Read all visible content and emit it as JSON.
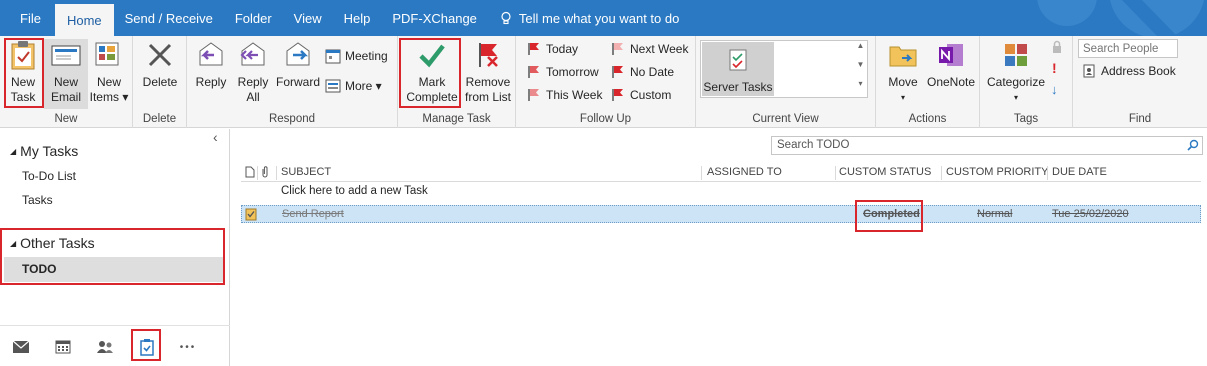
{
  "menubar": {
    "tabs": [
      "File",
      "Home",
      "Send / Receive",
      "Folder",
      "View",
      "Help",
      "PDF-XChange"
    ],
    "active_tab": "Home",
    "tell_me": "Tell me what you want to do"
  },
  "ribbon": {
    "new": {
      "label": "New",
      "new_task": [
        "New",
        "Task"
      ],
      "new_email": [
        "New",
        "Email"
      ],
      "new_items": [
        "New",
        "Items"
      ]
    },
    "delete": {
      "label": "Delete",
      "delete_btn": "Delete"
    },
    "respond": {
      "label": "Respond",
      "reply": "Reply",
      "reply_all": [
        "Reply",
        "All"
      ],
      "forward": "Forward",
      "meeting": "Meeting",
      "more": "More"
    },
    "manage_task": {
      "label": "Manage Task",
      "mark_complete": [
        "Mark",
        "Complete"
      ],
      "remove_from_list": [
        "Remove",
        "from List"
      ]
    },
    "follow_up": {
      "label": "Follow Up",
      "today": "Today",
      "tomorrow": "Tomorrow",
      "this_week": "This Week",
      "next_week": "Next Week",
      "no_date": "No Date",
      "custom": "Custom"
    },
    "current_view": {
      "label": "Current View",
      "server_tasks": "Server Tasks"
    },
    "actions": {
      "label": "Actions",
      "move": "Move",
      "onenote": "OneNote"
    },
    "tags": {
      "label": "Tags",
      "categorize": "Categorize"
    },
    "find": {
      "label": "Find",
      "search_people_placeholder": "Search People",
      "address_book": "Address Book"
    }
  },
  "nav": {
    "my_tasks": "My Tasks",
    "todo_list": "To-Do List",
    "tasks": "Tasks",
    "other_tasks": "Other Tasks",
    "todo": "TODO",
    "collapse_glyph": "‹",
    "more_glyph": "•••"
  },
  "main": {
    "search_placeholder": "Search TODO",
    "columns": {
      "subject": "SUBJECT",
      "assigned_to": "ASSIGNED TO",
      "custom_status": "CUSTOM STATUS",
      "custom_priority": "CUSTOM PRIORITY",
      "due_date": "DUE DATE"
    },
    "add_new": "Click here to add a new Task",
    "tasks": [
      {
        "subject": "Send Report",
        "assigned_to": "",
        "status": "Completed",
        "priority": "Normal",
        "due": "Tue 25/02/2020"
      }
    ]
  },
  "colors": {
    "accent": "#2b79c2",
    "highlight_red": "#d9262c",
    "selected_row": "#cde4f7",
    "mark_complete_green": "#2e9c6a"
  }
}
